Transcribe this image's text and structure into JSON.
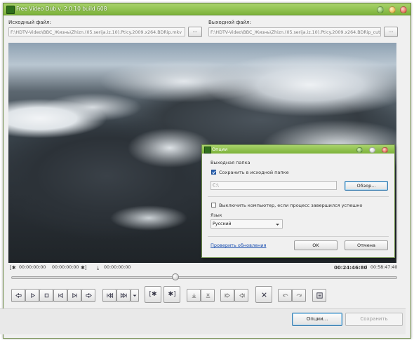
{
  "window": {
    "title": "Free Video Dub  v. 2.0.10 build 608"
  },
  "source": {
    "label": "Исходный файл:",
    "path": "F:\\HDTV-Video\\BBC_Жизнь\\Zhizn.(05.serija.iz.10).Pticy.2009.x264.BDRip.mkv",
    "browse": "..."
  },
  "output": {
    "label": "Выходной файл:",
    "path": "F:\\HDTV-Video\\BBC_Жизнь\\Zhizn.(05.serija.iz.10).Pticy.2009.x264.BDRip_cut.mkv",
    "browse": "..."
  },
  "timeline": {
    "sel_start": "00:00:00:00",
    "sel_end": "00:00:00:00",
    "position_marker": "00:00:00:00",
    "current_time": "00:24:46:80",
    "separator": "/",
    "total_time": "00:58:47:40",
    "slider_position_fraction": 0.426
  },
  "buttons": {
    "options": "Опции...",
    "save": "Сохранить"
  },
  "dialog": {
    "title": "Опции",
    "output_folder_label": "Выходная папка",
    "save_in_source_label": "Сохранить в исходной папке",
    "save_in_source_checked": true,
    "folder_path": "C:\\",
    "browse": "Обзор...",
    "shutdown_label": "Выключить компьютер, если процесс завершился успешно",
    "shutdown_checked": false,
    "language_label": "Язык",
    "language_value": "Русский",
    "check_updates": "Проверить обновления",
    "ok": "OK",
    "cancel": "Отмена"
  },
  "colors": {
    "titlebar": "#8fc14c",
    "link": "#1a4fb0"
  }
}
